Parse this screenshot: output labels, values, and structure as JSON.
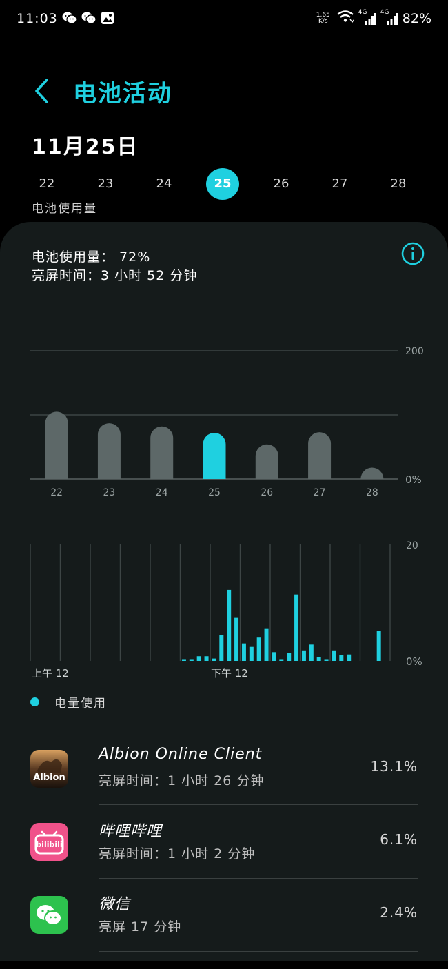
{
  "status_bar": {
    "time": "11:03",
    "net_speed_value": "1.65",
    "net_speed_unit": "K/s",
    "signal_label_1": "4G",
    "signal_label_2": "4G",
    "battery": "82%",
    "icons": [
      "wechat-icon",
      "wechat-icon",
      "gallery-icon",
      "wifi-icon",
      "signal-icon",
      "signal-icon"
    ]
  },
  "header": {
    "title": "电池活动",
    "date": "11月25日"
  },
  "days": [
    {
      "label": "22",
      "active": false
    },
    {
      "label": "23",
      "active": false
    },
    {
      "label": "24",
      "active": false
    },
    {
      "label": "25",
      "active": true
    },
    {
      "label": "26",
      "active": false
    },
    {
      "label": "27",
      "active": false
    },
    {
      "label": "28",
      "active": false
    }
  ],
  "usage_tab_label": "电池使用量",
  "summary": {
    "battery_usage": "电池使用量： 72%",
    "screen_time": "亮屏时间：3 小时 52 分钟"
  },
  "colors": {
    "accent": "#1fd0e0",
    "bar_inactive": "#5d6868",
    "card_bg": "#151b1b",
    "page_bg": "#000000"
  },
  "chart_data": [
    {
      "type": "bar",
      "categories": [
        "22",
        "23",
        "24",
        "25",
        "26",
        "27",
        "28"
      ],
      "values": [
        105,
        87,
        82,
        72,
        54,
        73,
        17
      ],
      "highlight": "25",
      "ylim": [
        0,
        200
      ],
      "ytick_labels": [
        "200",
        "0%"
      ],
      "gridlines": [
        0,
        100,
        200
      ]
    },
    {
      "type": "bar",
      "x_labels": [
        "上午 12",
        "下午 12"
      ],
      "values": [
        0,
        0,
        0,
        0,
        0,
        0,
        0,
        0,
        0,
        0,
        0,
        0,
        0,
        0,
        0,
        0,
        0,
        0,
        0,
        0,
        0.3,
        0.3,
        0.8,
        0.8,
        0.4,
        4.4,
        12.2,
        7.5,
        3,
        2.4,
        4,
        5.6,
        1.5,
        0.3,
        1.4,
        11.4,
        1.8,
        2.8,
        0.7,
        0.3,
        1.8,
        1,
        1.1,
        0,
        0,
        0,
        5.2,
        0
      ],
      "ylim": [
        0,
        20
      ],
      "ytick_labels": [
        "20",
        "0%"
      ],
      "vertical_grid_count": 13,
      "legend": "电量使用"
    }
  ],
  "apps": [
    {
      "name": "Albion Online Client",
      "screen_time": "亮屏时间：1 小时 26 分钟",
      "percent": "13.1%",
      "icon": "albion-app-icon",
      "icon_text": "Albion"
    },
    {
      "name": "哔哩哔哩",
      "screen_time": "亮屏时间：1 小时 2 分钟",
      "percent": "6.1%",
      "icon": "bilibili-app-icon",
      "icon_text": "bilibili"
    },
    {
      "name": "微信",
      "screen_time": "亮屏 17 分钟",
      "percent": "2.4%",
      "icon": "wechat-app-icon"
    }
  ]
}
